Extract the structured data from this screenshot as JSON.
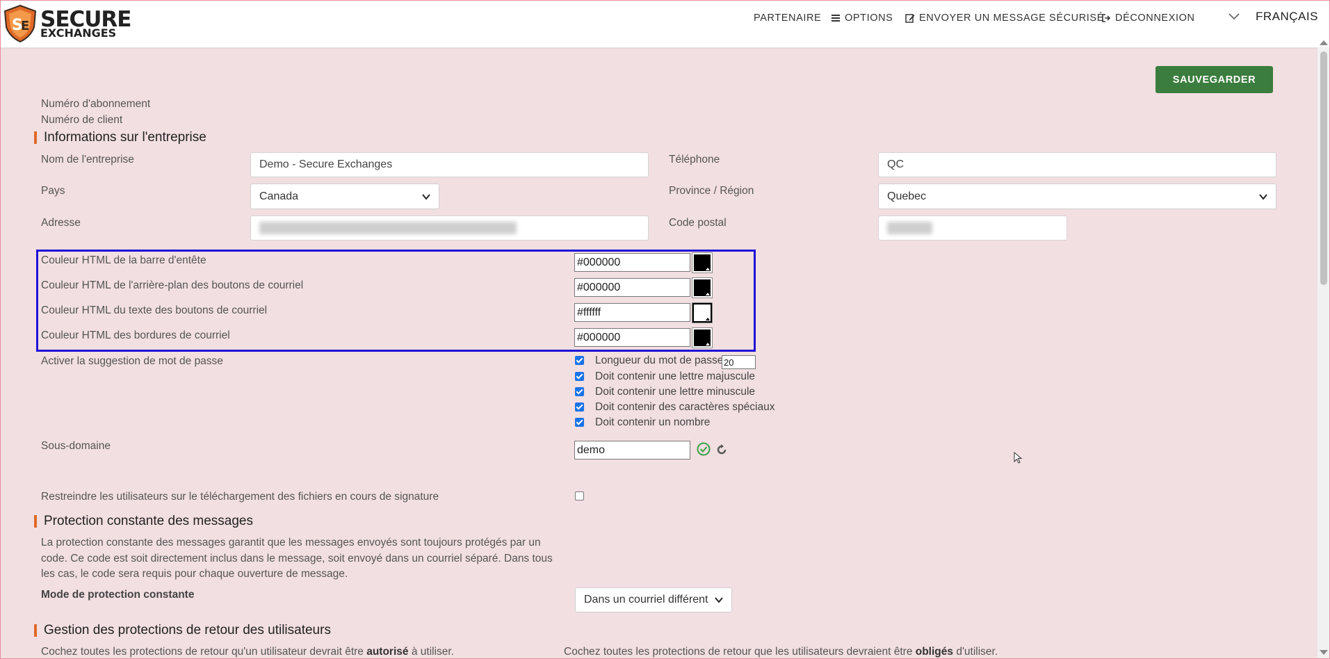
{
  "header": {
    "logo_line1": "SECURE",
    "logo_line2": "EXCHANGES",
    "nav_partenaire": "PARTENAIRE",
    "nav_options": "OPTIONS",
    "nav_send": "ENVOYER UN MESSAGE SÉCURISÉ",
    "nav_logout": "DÉCONNEXION",
    "language": "FRANÇAIS"
  },
  "actions": {
    "save_label": "SAUVEGARDER"
  },
  "account": {
    "subscription_label": "Numéro d'abonnement",
    "client_label": "Numéro de client"
  },
  "company": {
    "section_title": "Informations sur l'entreprise",
    "name_label": "Nom de l'entreprise",
    "name_value": "Demo - Secure Exchanges",
    "phone_label": "Téléphone",
    "phone_value": "QC",
    "country_label": "Pays",
    "country_value": "Canada",
    "province_label": "Province / Région",
    "province_value": "Quebec",
    "address_label": "Adresse",
    "postal_label": "Code postal"
  },
  "colors": {
    "header_bar_label": "Couleur HTML de la barre d'entête",
    "header_bar_value": "#000000",
    "button_bg_label": "Couleur HTML de l'arrière-plan des boutons de courriel",
    "button_bg_value": "#000000",
    "button_text_label": "Couleur HTML du texte des boutons de courriel",
    "button_text_value": "#ffffff",
    "border_label": "Couleur HTML des bordures de courriel",
    "border_value": "#000000",
    "highlight_color": "#1e10d6",
    "accent_color": "#e06a27",
    "save_color": "#3b7d3e"
  },
  "password": {
    "label": "Activer la suggestion de mot de passe",
    "length_label": "Longueur du mot de passe",
    "length_value": "20",
    "uppercase_label": "Doit contenir une lettre majuscule",
    "lowercase_label": "Doit contenir une lettre minuscule",
    "special_label": "Doit contenir des caractères spéciaux",
    "number_label": "Doit contenir un nombre"
  },
  "subdomain": {
    "label": "Sous-domaine",
    "value": "demo"
  },
  "restrict": {
    "label": "Restreindre les utilisateurs sur le téléchargement des fichiers en cours de signature"
  },
  "protection": {
    "section_title": "Protection constante des messages",
    "description": "La protection constante des messages garantit que les messages envoyés sont toujours protégés par un code. Ce code est soit directement inclus dans le message, soit envoyé dans un courriel séparé. Dans tous les cas, le code sera requis pour chaque ouverture de message.",
    "mode_label": "Mode de protection constante",
    "mode_value": "Dans un courriel différent"
  },
  "returns": {
    "section_title": "Gestion des protections de retour des utilisateurs",
    "left_pre": "Cochez toutes les protections de retour qu'un utilisateur devrait être ",
    "left_bold": "autorisé",
    "left_post": " à utiliser.",
    "right_pre": "Cochez toutes les protections de retour que les utilisateurs devraient être ",
    "right_bold": "obligés",
    "right_post": " d'utiliser."
  }
}
